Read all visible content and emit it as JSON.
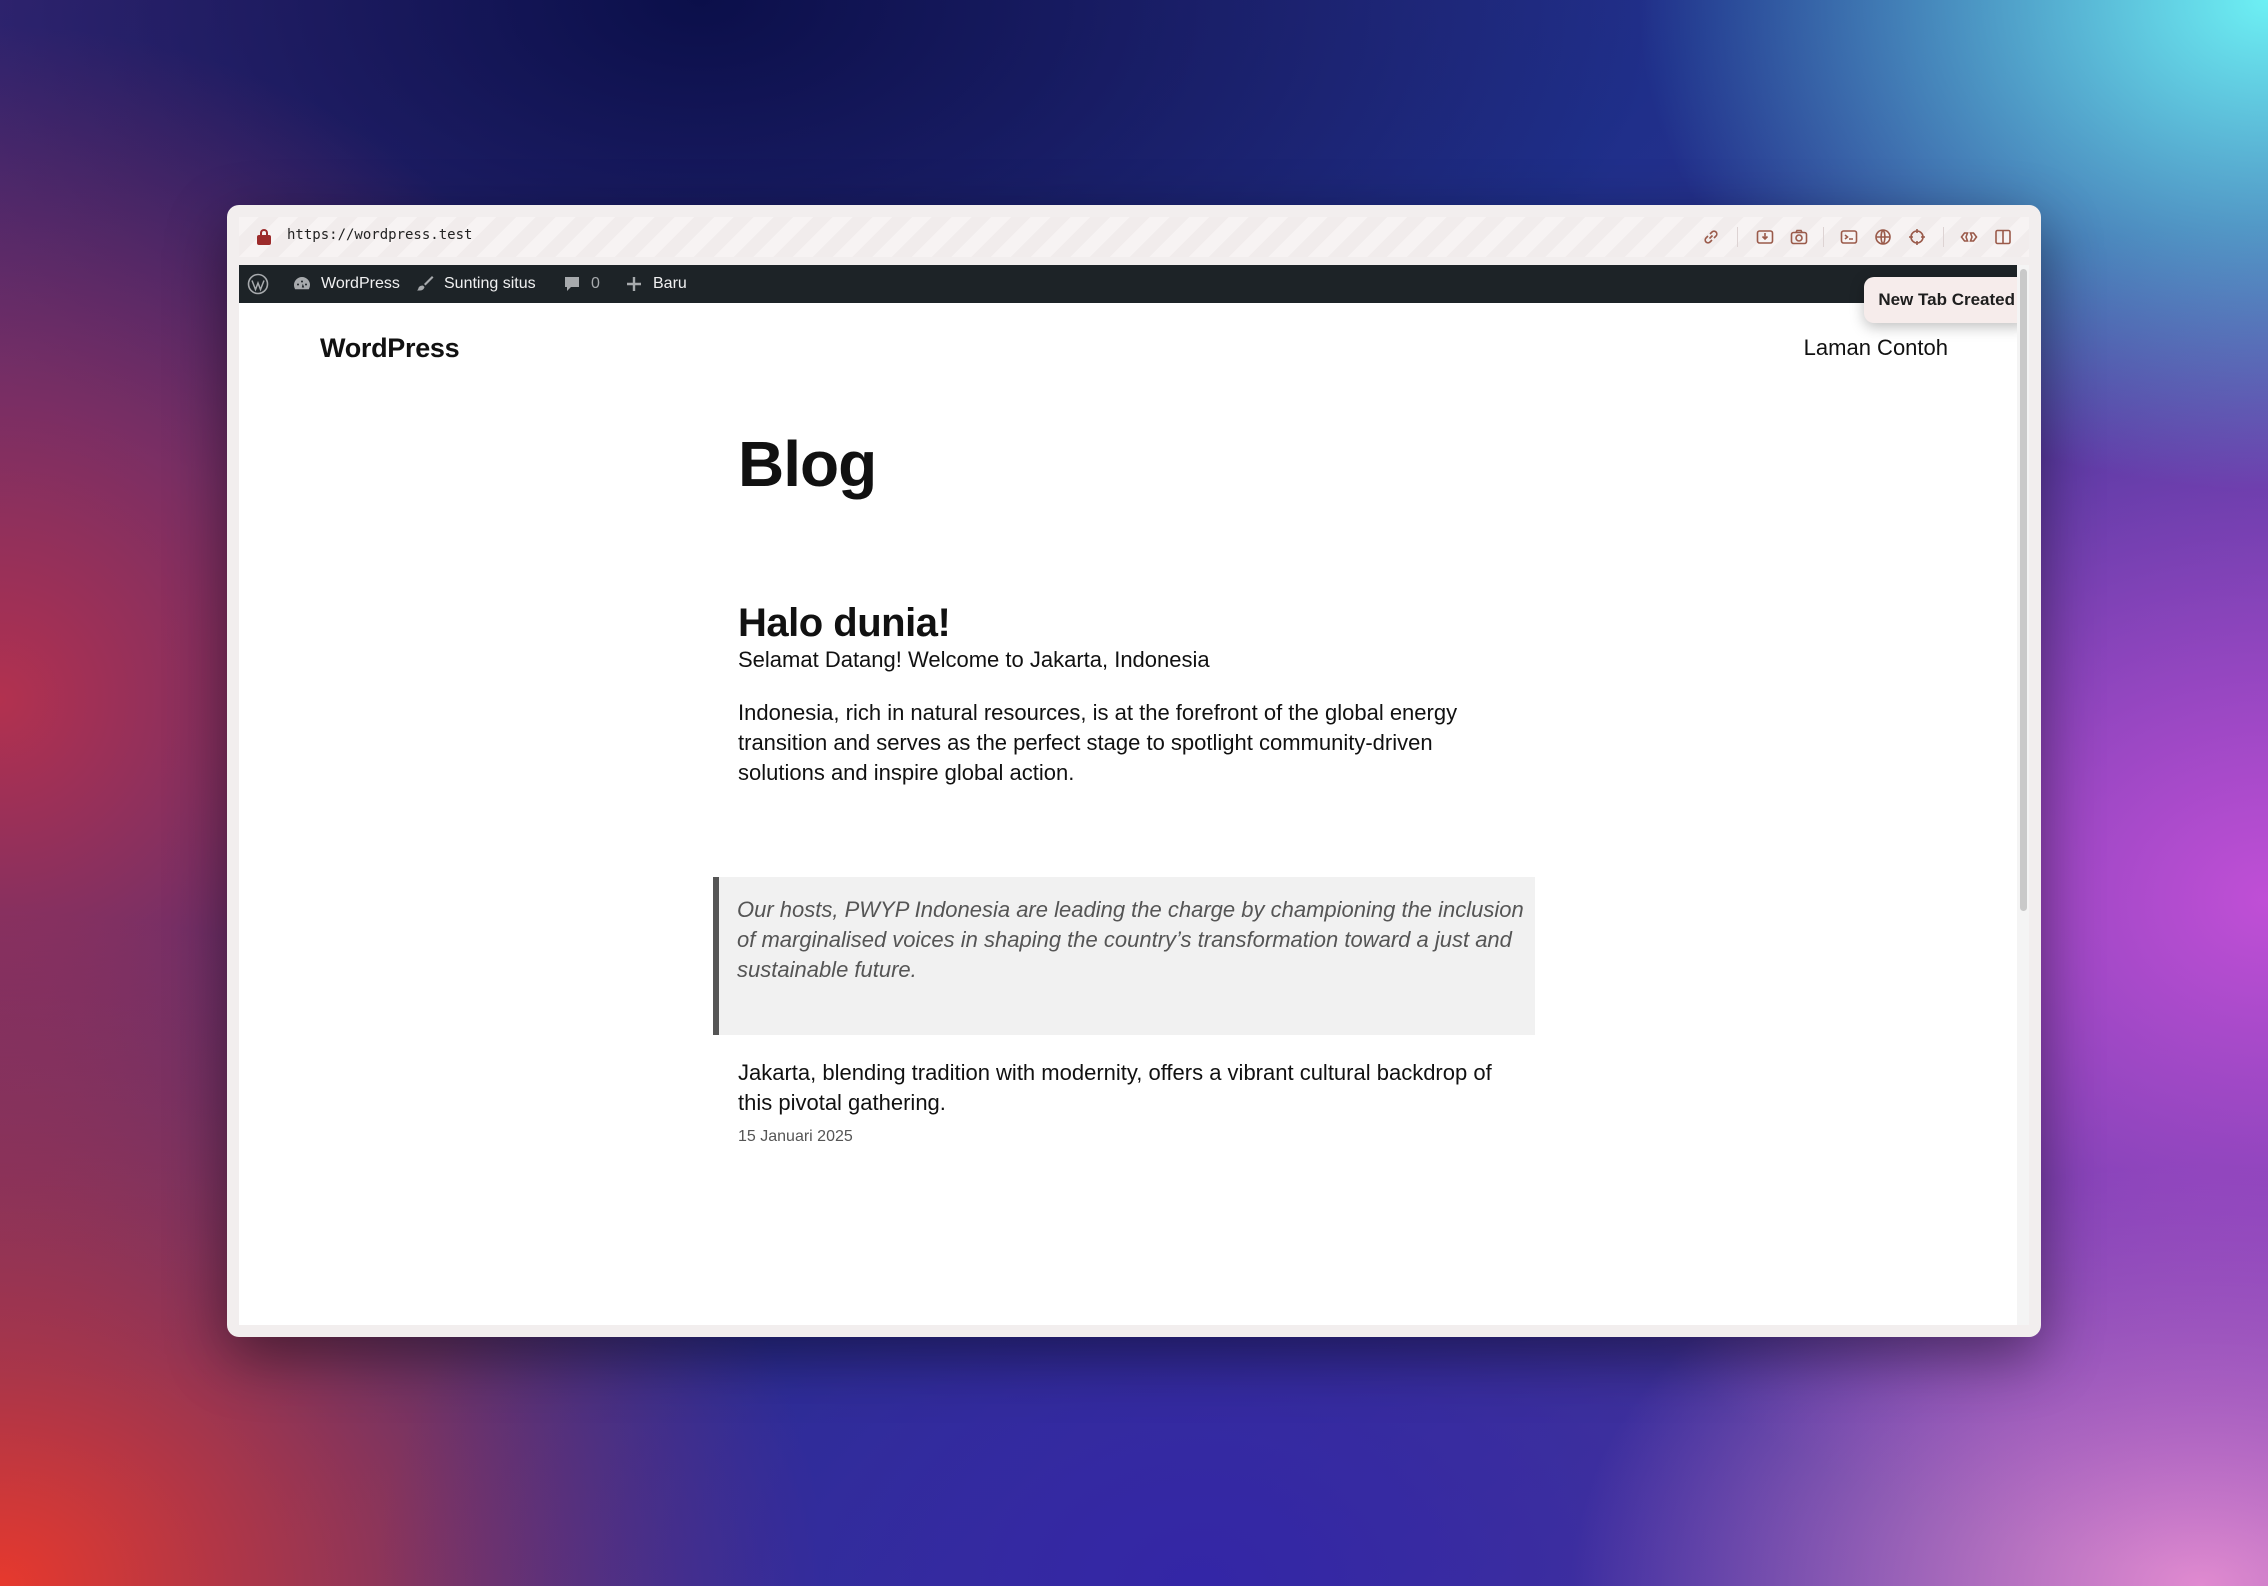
{
  "browser": {
    "url": "https://wordpress.test",
    "toolbar_icons": [
      "link-icon",
      "download-icon",
      "camera-icon",
      "terminal-icon",
      "globe-icon",
      "crosshair-icon",
      "extension-icon",
      "split-view-icon"
    ]
  },
  "admin_bar": {
    "wp_logo": "wordpress-logo-icon",
    "site_name": "WordPress",
    "customize": "Sunting situs",
    "comments_count": "0",
    "new": "Baru"
  },
  "toast": {
    "text": "New Tab Created"
  },
  "site": {
    "title": "WordPress",
    "nav": [
      "Laman Contoh"
    ]
  },
  "page": {
    "title": "Blog"
  },
  "post": {
    "title": "Halo dunia!",
    "paragraph_1": "Selamat Datang! Welcome to Jakarta, Indonesia",
    "paragraph_2": "Indonesia, rich in natural resources, is at the forefront of the global energy transition and serves as the perfect stage to spotlight community-driven solutions and inspire global action.",
    "quote": "Our hosts, PWYP Indonesia are leading the charge by championing the inclusion of marginalised voices in shaping the country’s transformation toward a just and sustainable future.",
    "paragraph_3": "Jakarta, blending tradition with modernity, offers a vibrant cultural backdrop of this pivotal gathering.",
    "date": "15 Januari 2025"
  },
  "colors": {
    "admin_bar_bg": "#1d2327",
    "accent_icon": "#9a5a4a",
    "lock": "#9c2b2b"
  }
}
